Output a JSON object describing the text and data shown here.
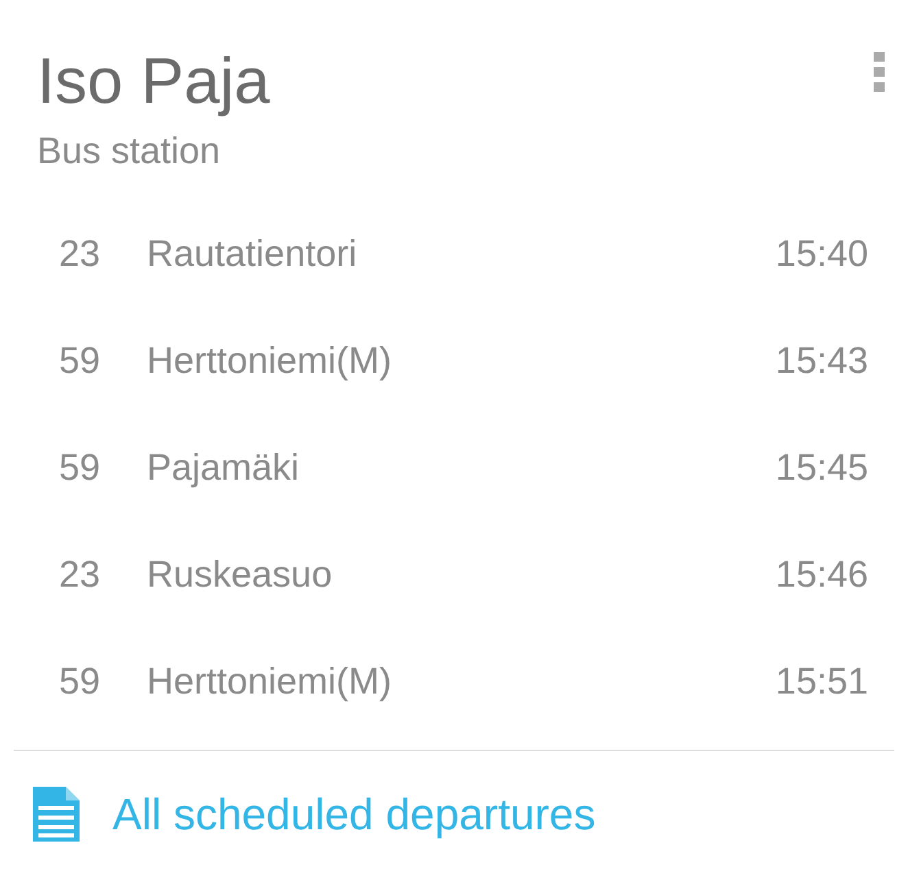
{
  "station": {
    "name": "Iso Paja",
    "type": "Bus station"
  },
  "departures": [
    {
      "route": "23",
      "destination": "Rautatientori",
      "time": "15:40"
    },
    {
      "route": "59",
      "destination": "Herttoniemi(M)",
      "time": "15:43"
    },
    {
      "route": "59",
      "destination": "Pajamäki",
      "time": "15:45"
    },
    {
      "route": "23",
      "destination": "Ruskeasuo",
      "time": "15:46"
    },
    {
      "route": "59",
      "destination": "Herttoniemi(M)",
      "time": "15:51"
    }
  ],
  "footer_link": {
    "label": "All scheduled departures"
  }
}
